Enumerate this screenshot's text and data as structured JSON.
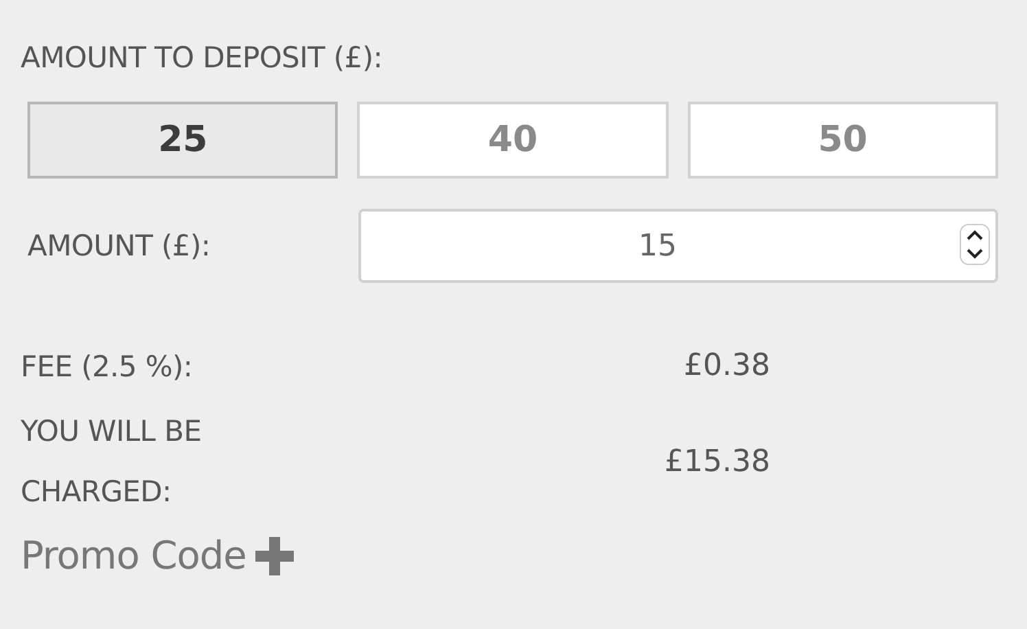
{
  "deposit_label": "AMOUNT TO DEPOSIT (£):",
  "presets": [
    {
      "label": "25",
      "selected": true
    },
    {
      "label": "40",
      "selected": false
    },
    {
      "label": "50",
      "selected": false
    }
  ],
  "amount": {
    "label": "AMOUNT (£):",
    "value": "15"
  },
  "fee": {
    "label": "FEE (2.5 %):",
    "value": "£0.38"
  },
  "charged": {
    "label": "YOU WILL BE CHARGED:",
    "value": "£15.38"
  },
  "promo": {
    "label": "Promo Code"
  }
}
